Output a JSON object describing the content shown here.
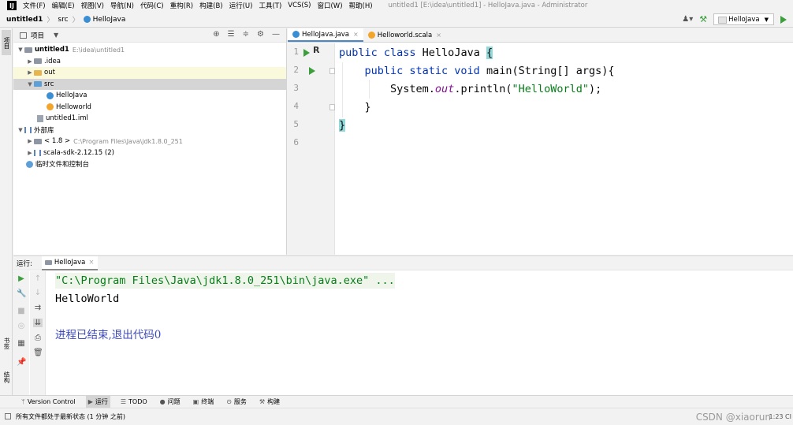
{
  "menubar": {
    "logo": "IJ",
    "items": [
      "文件(F)",
      "编辑(E)",
      "视图(V)",
      "导航(N)",
      "代码(C)",
      "重构(R)",
      "构建(B)",
      "运行(U)",
      "工具(T)",
      "VCS(S)",
      "窗口(W)",
      "帮助(H)"
    ],
    "window_title": "untitled1 [E:\\idea\\untitled1] - HelloJava.java - Administrator"
  },
  "navbar": {
    "project": "untitled1",
    "folder": "src",
    "file": "HelloJava",
    "run_config": "HelloJava"
  },
  "leftstrip": {
    "tab_project": "项目",
    "tab_bookmarks": "书签",
    "tab_structure": "结构"
  },
  "project_panel": {
    "title": "项目",
    "tree": [
      {
        "label": "untitled1",
        "path": "E:\\idea\\untitled1"
      },
      {
        "label": ".idea"
      },
      {
        "label": "out"
      },
      {
        "label": "src"
      },
      {
        "label": "HelloJava"
      },
      {
        "label": "Helloworld"
      },
      {
        "label": "untitled1.iml"
      },
      {
        "label": "外部库"
      },
      {
        "label": "< 1.8 >",
        "path": "C:\\Program Files\\Java\\jdk1.8.0_251"
      },
      {
        "label": "scala-sdk-2.12.15 (2)"
      },
      {
        "label": "临时文件和控制台"
      }
    ]
  },
  "editor": {
    "tabs": [
      {
        "label": "HelloJava.java",
        "close": "×"
      },
      {
        "label": "Helloworld.scala",
        "close": "×"
      }
    ],
    "line_numbers": [
      "1",
      "2",
      "3",
      "4",
      "5",
      "6"
    ],
    "code": {
      "l1_kw": "public class",
      "l1_name": " HelloJava ",
      "l1_brace": "{",
      "l2_indent": "    ",
      "l2_kw": "public static void",
      "l2_rest": " main(String[] args){",
      "l3_pre": "        System.",
      "l3_field": "out",
      "l3_mid": ".println(",
      "l3_str": "\"HelloWorld\"",
      "l3_end": ");",
      "l4": "    }",
      "l5_brace": "}"
    }
  },
  "run_panel": {
    "label": "运行:",
    "tab": "HelloJava",
    "tab_close": "×",
    "console": {
      "cmd": "\"C:\\Program Files\\Java\\jdk1.8.0_251\\bin\\java.exe\" ...",
      "output": "HelloWorld",
      "exit": "进程已结束,退出代码0"
    }
  },
  "bottom_tabs": [
    "Version Control",
    "运行",
    "TODO",
    "问题",
    "终端",
    "服务",
    "构建"
  ],
  "statusbar": {
    "message": "所有文件都处于最新状态 (1 分钟 之前)",
    "watermark": "CSDN @xiaorun",
    "position": "1:23 CI"
  }
}
